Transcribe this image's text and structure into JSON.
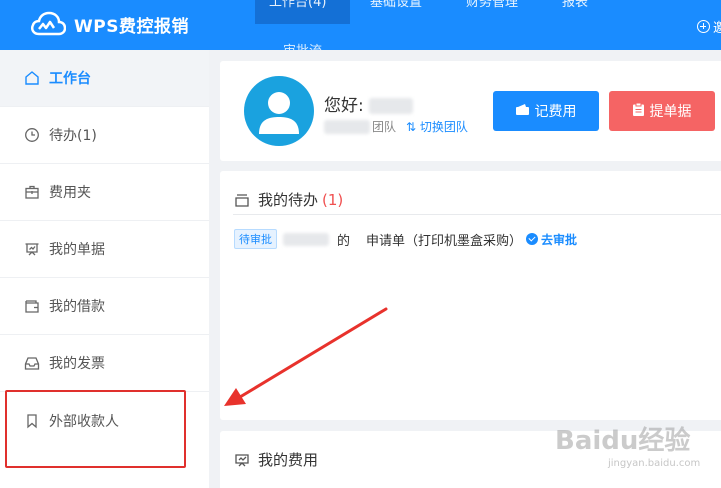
{
  "app": {
    "title": "WPS费控报销"
  },
  "header": {
    "tabs": [
      {
        "label": "工作台(4)",
        "active": true
      },
      {
        "label": "基础设置",
        "active": false
      },
      {
        "label": "财务管理",
        "active": false
      },
      {
        "label": "报表",
        "active": false
      }
    ],
    "tabs_row2": [
      "审批流"
    ],
    "right_label": "邀"
  },
  "sidebar": {
    "items": [
      {
        "label": "工作台",
        "icon": "home-icon",
        "active": true
      },
      {
        "label": "待办(1)",
        "icon": "clock-icon",
        "active": false
      },
      {
        "label": "费用夹",
        "icon": "briefcase-icon",
        "active": false
      },
      {
        "label": "我的单据",
        "icon": "document-board-icon",
        "active": false
      },
      {
        "label": "我的借款",
        "icon": "wallet-icon",
        "active": false
      },
      {
        "label": "我的发票",
        "icon": "inbox-icon",
        "active": false
      },
      {
        "label": "外部收款人",
        "icon": "bookmark-icon",
        "active": false
      }
    ]
  },
  "profile": {
    "greeting": "您好:",
    "team_suffix": "团队",
    "switch_team": "切换团队",
    "record_button": "记费用",
    "submit_button": "提单据"
  },
  "todo": {
    "title": "我的待办",
    "count": "(1)",
    "row": {
      "tag": "待审批",
      "of": "的",
      "text": "申请单（打印机墨盒采购）",
      "action": "去审批"
    }
  },
  "expenses": {
    "title": "我的费用"
  },
  "watermark": {
    "text": "Baidu经验",
    "sub": "jingyan.baidu.com"
  },
  "colors": {
    "primary": "#1a8cff",
    "danger": "#f56464",
    "highlight": "#e0302d"
  }
}
